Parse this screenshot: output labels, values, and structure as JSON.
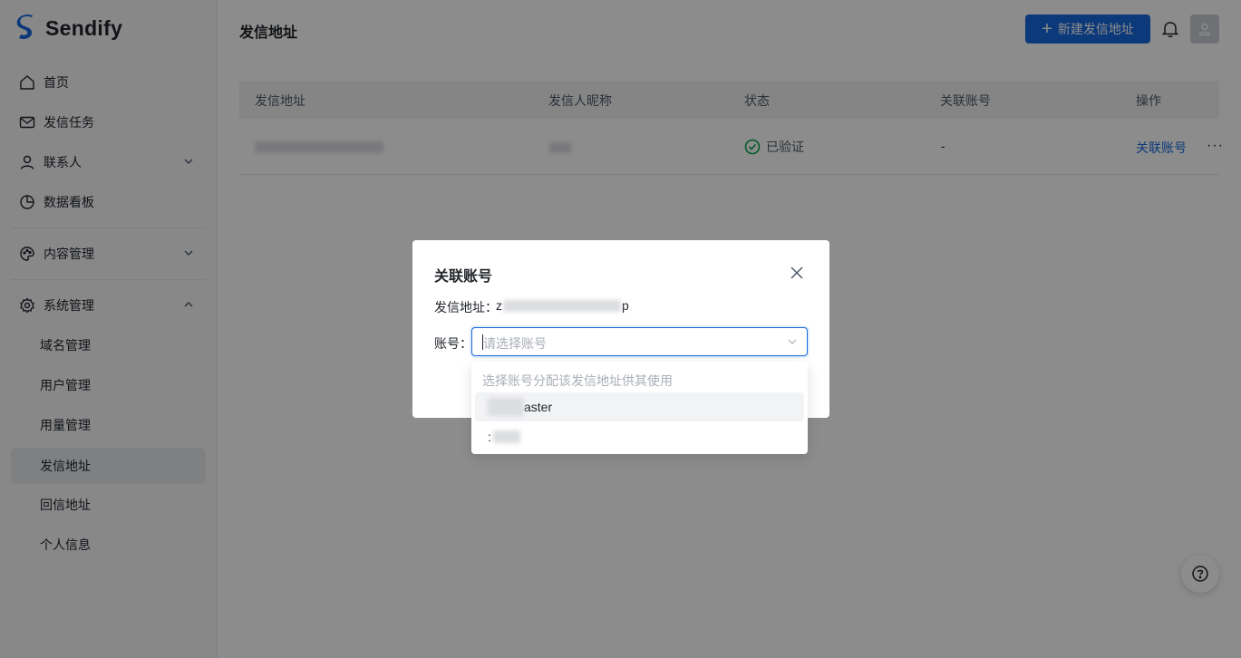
{
  "app": {
    "name": "Sendify",
    "brand_color": "#1668dc"
  },
  "sidebar": {
    "items": [
      {
        "label": "首页",
        "icon": "home-icon"
      },
      {
        "label": "发信任务",
        "icon": "mail-icon"
      },
      {
        "label": "联系人",
        "icon": "user-icon",
        "expandable": true,
        "expanded": false
      },
      {
        "label": "数据看板",
        "icon": "pie-chart-icon"
      },
      {
        "label": "内容管理",
        "icon": "palette-icon",
        "expandable": true,
        "expanded": false
      },
      {
        "label": "系统管理",
        "icon": "gear-icon",
        "expandable": true,
        "expanded": true
      }
    ],
    "sub_items": [
      {
        "label": "域名管理"
      },
      {
        "label": "用户管理"
      },
      {
        "label": "用量管理"
      },
      {
        "label": "发信地址",
        "active": true
      },
      {
        "label": "回信地址"
      },
      {
        "label": "个人信息"
      }
    ]
  },
  "header": {
    "title": "发信地址",
    "new_button": "新建发信地址"
  },
  "table": {
    "columns": [
      "发信地址",
      "发信人昵称",
      "状态",
      "关联账号",
      "操作"
    ],
    "rows": [
      {
        "address": "",
        "nickname": "",
        "status": "已验证",
        "account": "-",
        "action": "关联账号",
        "more": "···"
      }
    ]
  },
  "modal": {
    "title": "关联账号",
    "address_label": "发信地址：",
    "address_prefix": "z",
    "address_suffix": "p",
    "account_label": "账号：",
    "select_placeholder": "请选择账号"
  },
  "dropdown": {
    "hint": "选择账号分配该发信地址供其使用",
    "options": [
      {
        "label": "aster",
        "hovered": true
      },
      {
        "label": ":"
      }
    ]
  },
  "help": {
    "icon": "help-icon"
  }
}
